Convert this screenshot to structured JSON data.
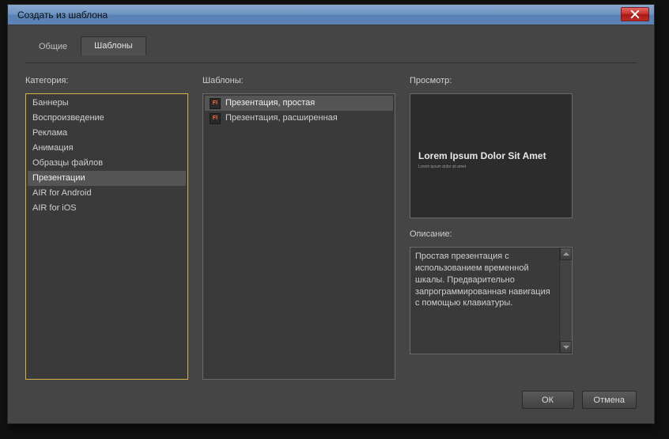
{
  "window": {
    "title": "Создать из шаблона"
  },
  "tabs": {
    "general": "Общие",
    "templates": "Шаблоны"
  },
  "labels": {
    "category": "Категория:",
    "templates": "Шаблоны:",
    "preview": "Просмотр:",
    "description": "Описание:"
  },
  "categories": [
    "Баннеры",
    "Воспроизведение",
    "Реклама",
    "Анимация",
    "Образцы файлов",
    "Презентации",
    "AIR for Android",
    "AIR for iOS"
  ],
  "category_selected_index": 5,
  "templates": [
    "Презентация, простая",
    "Презентация, расширенная"
  ],
  "template_selected_index": 0,
  "preview": {
    "title": "Lorem Ipsum Dolor Sit Amet",
    "subtitle": "Lorem ipsum dolor sit amet"
  },
  "description_text": "Простая презентация с использованием временной шкалы. Предварительно запрограммированная навигация с помощью клавиатуры.",
  "buttons": {
    "ok": "ОК",
    "cancel": "Отмена"
  }
}
